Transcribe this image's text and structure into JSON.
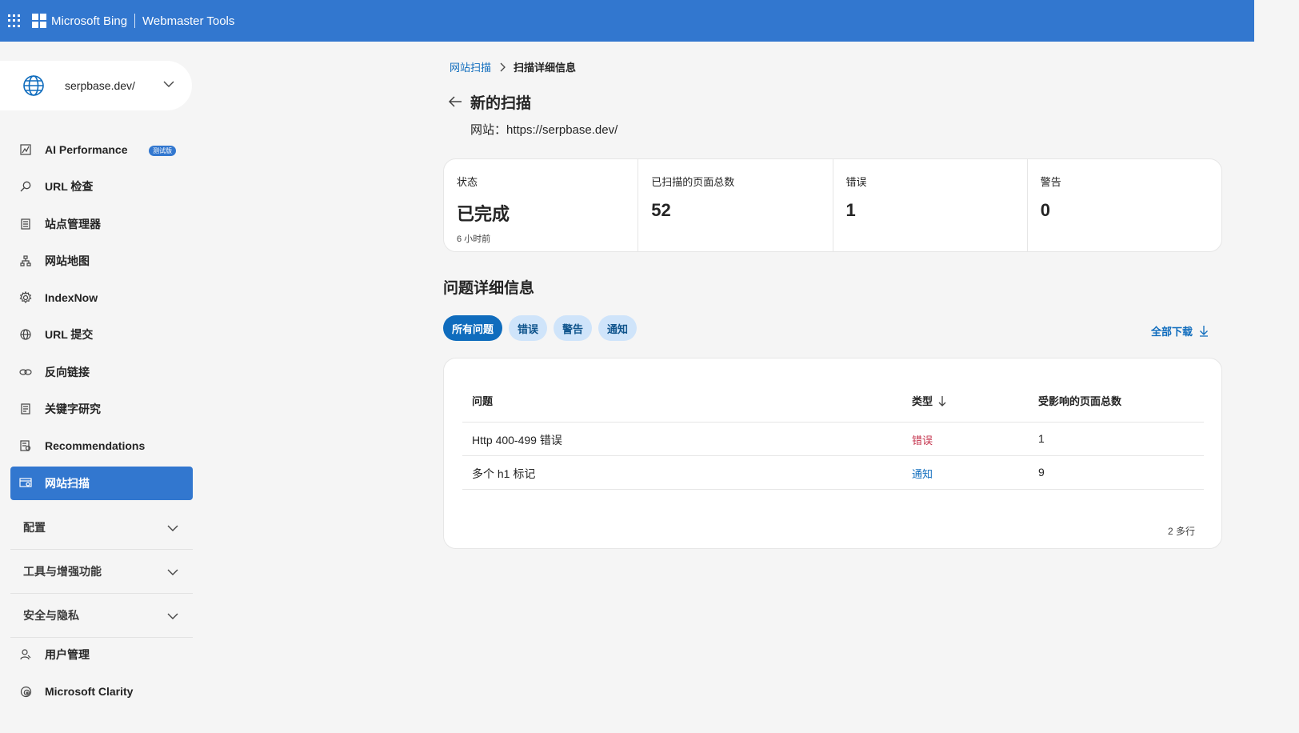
{
  "topbar": {
    "brand": "Microsoft Bing",
    "product": "Webmaster Tools"
  },
  "site_selector": {
    "site": "serpbase.dev/"
  },
  "nav": {
    "items": [
      {
        "label": "AI Performance",
        "icon": "ai-performance-icon",
        "badge": "测试版"
      },
      {
        "label": "URL 检查",
        "icon": "search-icon"
      },
      {
        "label": "站点管理器",
        "icon": "document-icon"
      },
      {
        "label": "网站地图",
        "icon": "sitemap-icon"
      },
      {
        "label": "IndexNow",
        "icon": "gear-icon"
      },
      {
        "label": "URL 提交",
        "icon": "globe-icon"
      },
      {
        "label": "反向链接",
        "icon": "link-icon"
      },
      {
        "label": "关键字研究",
        "icon": "document-icon"
      },
      {
        "label": "Recommendations",
        "icon": "recommendations-icon"
      },
      {
        "label": "网站扫描",
        "icon": "site-scan-icon",
        "active": true
      }
    ],
    "sections": [
      "配置",
      "工具与增强功能",
      "安全与隐私"
    ],
    "bottom_items": [
      {
        "label": "用户管理",
        "icon": "user-icon"
      },
      {
        "label": "Microsoft Clarity",
        "icon": "clarity-icon"
      }
    ]
  },
  "breadcrumb": {
    "parent": "网站扫描",
    "current": "扫描详细信息"
  },
  "page": {
    "title": "新的扫描",
    "site_line": "网站：https://serpbase.dev/"
  },
  "stats": {
    "status": {
      "label": "状态",
      "value": "已完成",
      "sub": "6 小时前"
    },
    "pages": {
      "label": "已扫描的页面总数",
      "value": "52"
    },
    "errors": {
      "label": "错误",
      "value": "1"
    },
    "warnings": {
      "label": "警告",
      "value": "0"
    }
  },
  "issues": {
    "title": "问题详细信息",
    "filters": [
      "所有问题",
      "错误",
      "警告",
      "通知"
    ],
    "active_filter": "所有问题",
    "download_label": "全部下载",
    "columns": [
      "问题",
      "类型",
      "受影响的页面总数"
    ],
    "rows": [
      {
        "issue": "Http 400-499 错误",
        "type": "错误",
        "type_color": "#c4314b",
        "count": "1"
      },
      {
        "issue": "多个 h1 标记",
        "type": "通知",
        "type_color": "#0f6cbd",
        "count": "9"
      }
    ],
    "row_count": "2 多行"
  },
  "colors": {
    "accent": "#3277cf",
    "link": "#0f6cbd",
    "error": "#c4314b"
  }
}
